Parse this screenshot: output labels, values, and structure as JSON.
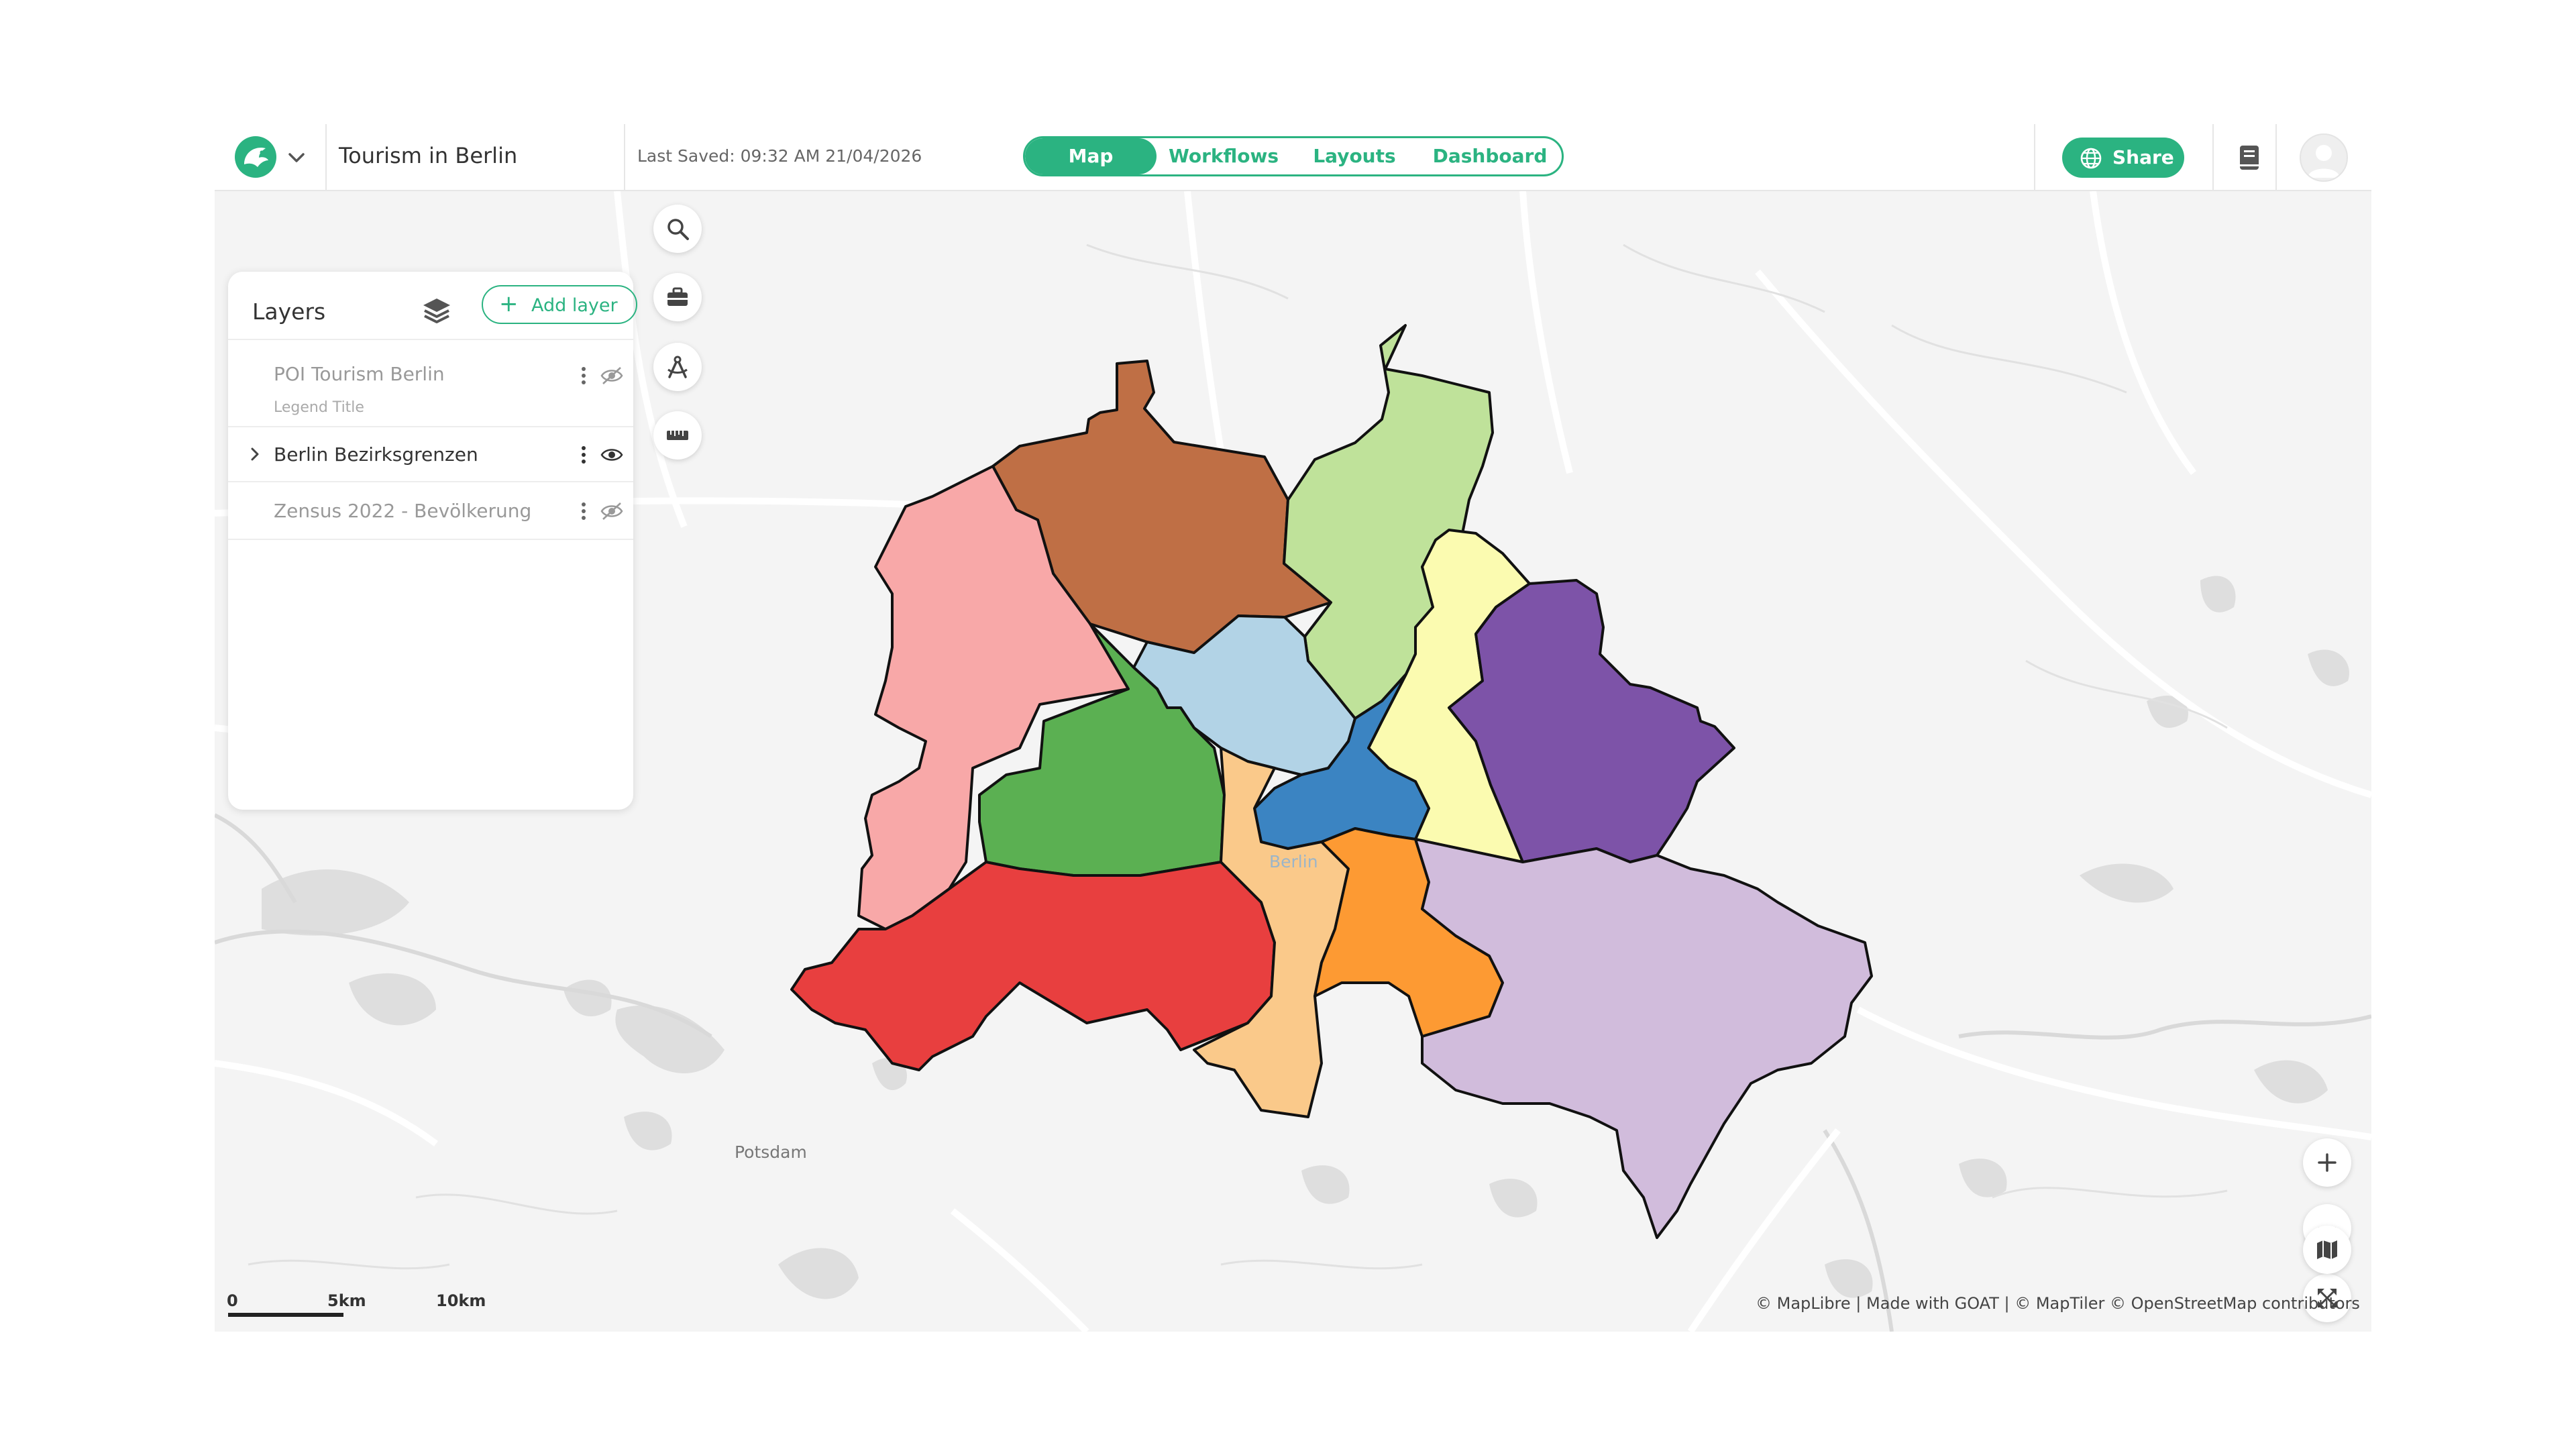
{
  "header": {
    "project_title": "Tourism in Berlin",
    "last_saved": "Last Saved: 09:32 AM 21/04/2026",
    "tabs": [
      {
        "label": "Map",
        "active": true
      },
      {
        "label": "Workflows",
        "active": false
      },
      {
        "label": "Layouts",
        "active": false
      },
      {
        "label": "Dashboard",
        "active": false
      }
    ],
    "share_label": "Share",
    "icons": {
      "logo": "goat-logo-icon",
      "chevron": "chevron-down-icon",
      "share": "globe-icon",
      "docs": "book-icon",
      "avatar": "user-avatar-icon"
    }
  },
  "layers_panel": {
    "title": "Layers",
    "add_layer_label": "Add layer",
    "layers": [
      {
        "name": "POI Tourism Berlin",
        "subtitle": "Legend Title",
        "visible": false
      },
      {
        "name": "Berlin Bezirksgrenzen",
        "visible": true
      },
      {
        "name": "Zensus 2022 - Bevölkerung",
        "visible": false
      }
    ]
  },
  "map": {
    "labels": {
      "berlin": "Berlin",
      "potsdam": "Potsdam"
    },
    "scale": {
      "zero": "0",
      "mid": "5km",
      "max": "10km"
    },
    "attribution": "© MapLibre | Made with GOAT | © MapTiler © OpenStreetMap contributors",
    "district_colors": [
      "#bf6f45",
      "#bfe29a",
      "#fbfbb0",
      "#7d53a8",
      "#f8a8a8",
      "#b2d3e6",
      "#5bb052",
      "#3b84c2",
      "#e83f3f",
      "#fac98a",
      "#fd9a33",
      "#d1bcdc"
    ],
    "toolbar_icons": [
      "search-icon",
      "toolbox-icon",
      "compass-icon",
      "ruler-icon"
    ],
    "control_icons": [
      "zoom-in-icon",
      "zoom-out-icon",
      "fullscreen-icon",
      "basemap-icon"
    ]
  },
  "colors": {
    "accent": "#2bb381"
  }
}
